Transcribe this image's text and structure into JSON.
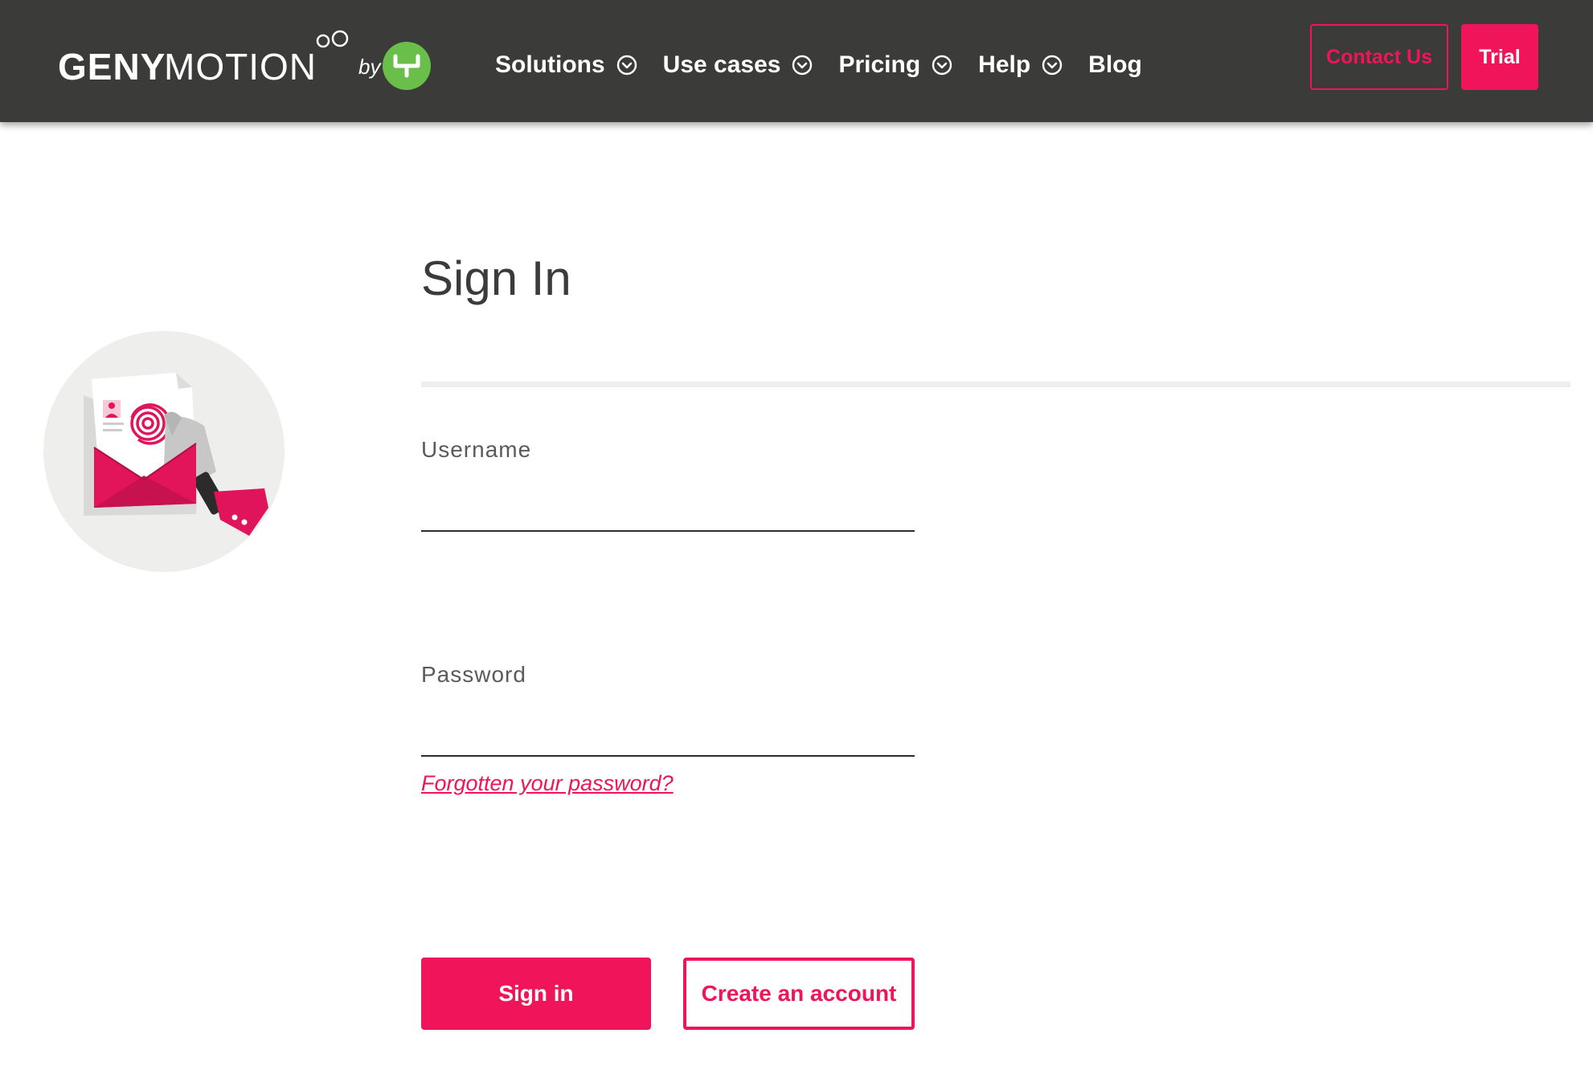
{
  "header": {
    "logo": {
      "brand_bold": "GENY",
      "brand_light": "MOTION",
      "by_text": "by"
    },
    "nav": [
      {
        "label": "Solutions",
        "has_dropdown": true,
        "icon": "chevron-down-circle-icon"
      },
      {
        "label": "Use cases",
        "has_dropdown": true,
        "icon": "chevron-down-circle-icon"
      },
      {
        "label": "Pricing",
        "has_dropdown": true,
        "icon": "chevron-down-circle-icon"
      },
      {
        "label": "Help",
        "has_dropdown": true,
        "icon": "chevron-down-circle-icon"
      },
      {
        "label": "Blog",
        "has_dropdown": false
      }
    ],
    "contact_label": "Contact Us",
    "trial_label": "Trial"
  },
  "form": {
    "title": "Sign In",
    "username": {
      "label": "Username",
      "value": "",
      "placeholder": ""
    },
    "password": {
      "label": "Password",
      "value": "",
      "placeholder": ""
    },
    "forgot_link": "Forgotten your password?",
    "signin_label": "Sign in",
    "create_label": "Create an account"
  },
  "illustration": {
    "icon": "fingerprint-envelope-illustration"
  },
  "colors": {
    "header_bg": "#3b3b3a",
    "accent": "#f0145a",
    "logo_badge": "#6abf4b",
    "divider": "#eeeeee"
  }
}
